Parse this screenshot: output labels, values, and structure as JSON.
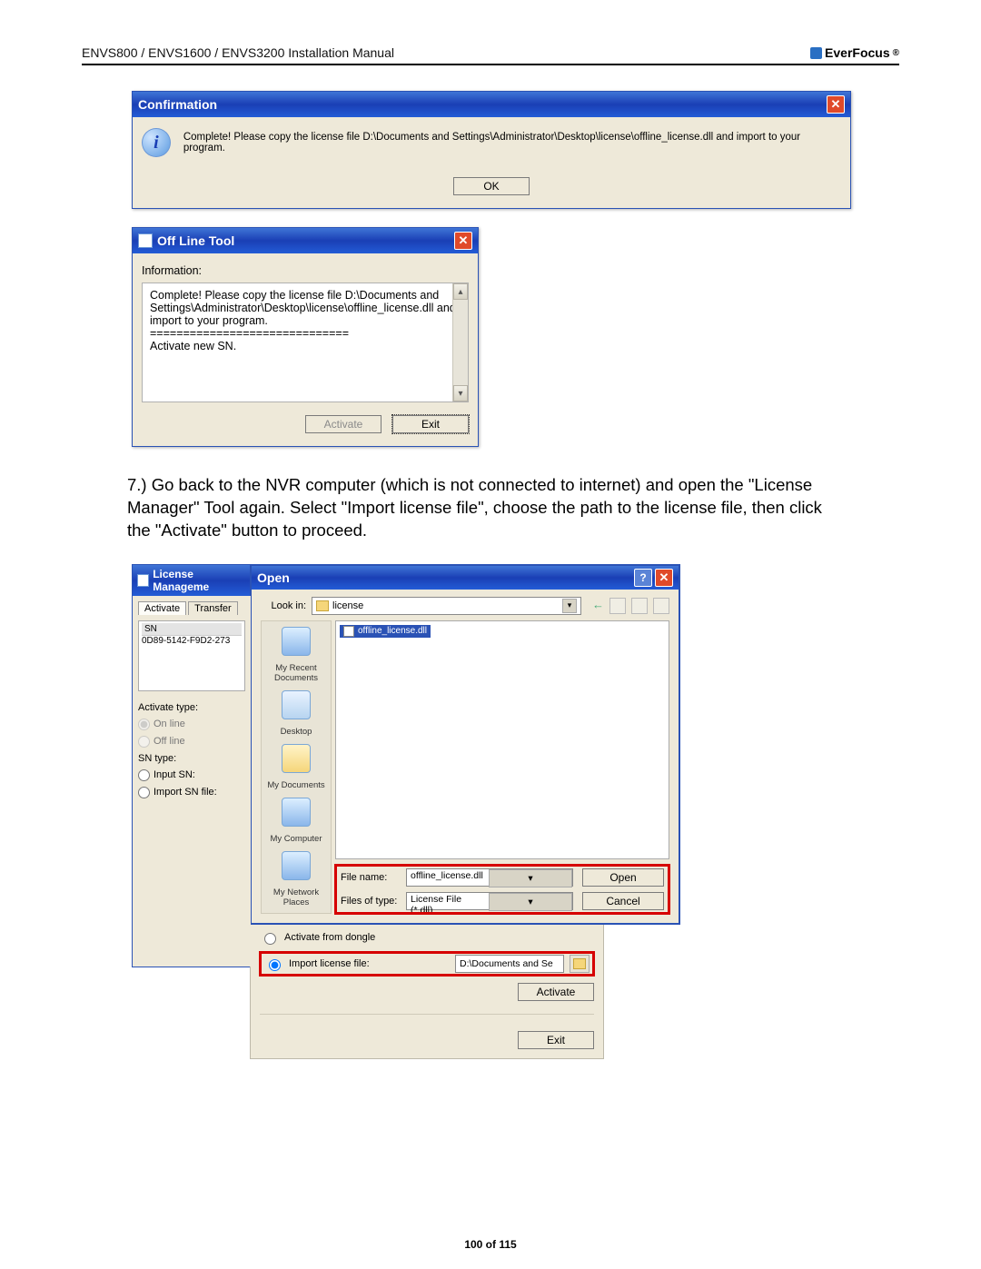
{
  "header": {
    "title": "ENVS800 / ENVS1600 / ENVS3200 Installation Manual",
    "brand": "EverFocus"
  },
  "confirmation": {
    "title": "Confirmation",
    "message": "Complete! Please copy the license file D:\\Documents and Settings\\Administrator\\Desktop\\license\\offline_license.dll and import to your program.",
    "ok": "OK"
  },
  "offline_tool": {
    "title": "Off Line Tool",
    "info_label": "Information:",
    "text": "Complete! Please copy the license file D:\\Documents and Settings\\Administrator\\Desktop\\license\\offline_license.dll and import to your program.\n==============================\nActivate new SN.",
    "activate": "Activate",
    "exit": "Exit"
  },
  "step7": "7.) Go back to the NVR computer (which is not connected to internet) and open the \"License Manager\" Tool again. Select \"Import license file\", choose the path to the license file, then click the \"Activate\" button to proceed.",
  "license_manager": {
    "title": "License Manageme",
    "tabs": {
      "activate": "Activate",
      "transfer": "Transfer"
    },
    "sn_header": "SN",
    "sn_value": "0D89-5142-F9D2-273",
    "activate_type": "Activate type:",
    "on_line": "On line",
    "off_line": "Off line",
    "sn_type": "SN type:",
    "input_sn": "Input SN:",
    "import_sn_file": "Import SN file:",
    "activate_from_dongle": "Activate from dongle",
    "import_license_file": "Import license file:",
    "path_value": "D:\\Documents and Se",
    "activate_btn": "Activate",
    "exit_btn": "Exit"
  },
  "open_dialog": {
    "title": "Open",
    "look_in": "Look in:",
    "folder": "license",
    "places": [
      "My Recent Documents",
      "Desktop",
      "My Documents",
      "My Computer",
      "My Network Places"
    ],
    "file": "offline_license.dll",
    "file_name_label": "File name:",
    "file_name_value": "offline_license.dll",
    "files_of_type_label": "Files of type:",
    "files_of_type_value": "License File (*.dll)",
    "open_btn": "Open",
    "cancel_btn": "Cancel"
  },
  "footer": "100 of 115"
}
